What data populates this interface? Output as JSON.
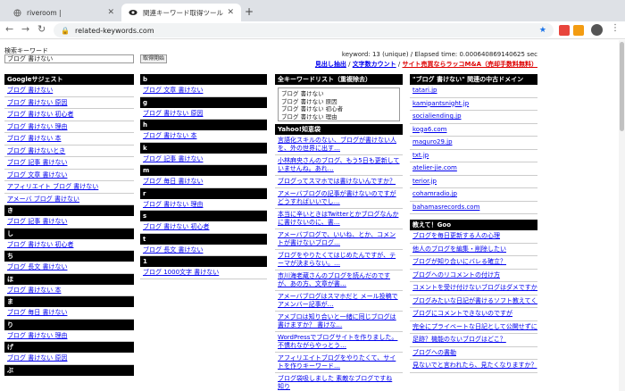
{
  "browser": {
    "tabs": [
      {
        "title": "riveroom |",
        "active": false
      },
      {
        "title": "関連キーワード取得ツール（仮名",
        "active": true
      }
    ],
    "url": "related-keywords.com"
  },
  "search": {
    "label": "検索キーワード",
    "value": "ブログ 書けない",
    "button": "取得開始"
  },
  "stats": "keyword: 13 (unique) / Elapsed time: 0.000640869140625 sec",
  "links": {
    "headings": "見出し抽出",
    "sep1": " / ",
    "count": "文字数カウント",
    "sep2": " / ",
    "sale": "サイト売買ならラッコM&A（売却手数料無料）"
  },
  "col1": [
    {
      "type": "hdr",
      "text": "Googleサジェスト"
    },
    {
      "type": "item",
      "text": "ブログ 書けない"
    },
    {
      "type": "item",
      "text": "ブログ 書けない 原因"
    },
    {
      "type": "item",
      "text": "ブログ 書けない 初心者"
    },
    {
      "type": "item",
      "text": "ブログ 書けない 理由"
    },
    {
      "type": "item",
      "text": "ブログ 書けない 本"
    },
    {
      "type": "item",
      "text": "ブログ 書けないとき"
    },
    {
      "type": "item",
      "text": "ブログ 記事 書けない"
    },
    {
      "type": "item",
      "text": "ブログ 文章 書けない"
    },
    {
      "type": "item",
      "text": "アフィリエイト ブログ 書けない"
    },
    {
      "type": "item",
      "text": "アメーバ ブログ 書けない"
    },
    {
      "type": "hdr",
      "text": "き"
    },
    {
      "type": "item",
      "text": "ブログ 記事 書けない"
    },
    {
      "type": "hdr",
      "text": "し"
    },
    {
      "type": "item",
      "text": "ブログ 書けない 初心者"
    },
    {
      "type": "hdr",
      "text": "ち"
    },
    {
      "type": "item",
      "text": "ブログ 長文 書けない"
    },
    {
      "type": "hdr",
      "text": "ほ"
    },
    {
      "type": "item",
      "text": "ブログ 書けない 本"
    },
    {
      "type": "hdr",
      "text": "ま"
    },
    {
      "type": "item",
      "text": "ブログ 毎日 書けない"
    },
    {
      "type": "hdr",
      "text": "り"
    },
    {
      "type": "item",
      "text": "ブログ 書けない 理由"
    },
    {
      "type": "hdr",
      "text": "げ"
    },
    {
      "type": "item",
      "text": "ブログ 書けない 原因"
    },
    {
      "type": "hdr",
      "text": "ぶ"
    }
  ],
  "col2": [
    {
      "type": "hdr",
      "text": "b"
    },
    {
      "type": "item",
      "text": "ブログ 文章 書けない"
    },
    {
      "type": "hdr",
      "text": "g"
    },
    {
      "type": "item",
      "text": "ブログ 書けない 原因"
    },
    {
      "type": "hdr",
      "text": "h"
    },
    {
      "type": "item",
      "text": "ブログ 書けない 本"
    },
    {
      "type": "hdr",
      "text": "k"
    },
    {
      "type": "item",
      "text": "ブログ 記事 書けない"
    },
    {
      "type": "hdr",
      "text": "m"
    },
    {
      "type": "item",
      "text": "ブログ 毎日 書けない"
    },
    {
      "type": "hdr",
      "text": "r"
    },
    {
      "type": "item",
      "text": "ブログ 書けない 理由"
    },
    {
      "type": "hdr",
      "text": "s"
    },
    {
      "type": "item",
      "text": "ブログ 書けない 初心者"
    },
    {
      "type": "hdr",
      "text": "t"
    },
    {
      "type": "item",
      "text": "ブログ 長文 書けない"
    },
    {
      "type": "hdr",
      "text": "1"
    },
    {
      "type": "item",
      "text": "ブログ 1000文字 書けない"
    }
  ],
  "col3": {
    "header": "全キーワードリスト（重複除去）",
    "textarea_lines": [
      "ブログ 書けない",
      "ブログ 書けない 原因",
      "ブログ 書けない 初心者",
      "ブログ 書けない 理由"
    ],
    "yahoo_header": "Yahoo!知恵袋",
    "yahoo_items": [
      "言語化スキルのない、ブログが書けない人を、外の世界に出す…",
      "小林麻央さんのブログ、もう5日も更新していませんね。あれ…",
      "ブログってスマホでは書けないんですか？",
      "アメーバブログの記事が書けないのですがどうすればいいでし…",
      "本当に辛いときはTwitterとかブログなんかに書けないのに、書…",
      "アメーバブログで、いいね、とか、コメントが書けないブログ…",
      "ブログをやりたくてはじめたんですが、テーマが決まらない。…",
      "市川海老蔵さんのブログを読んだのですが、あの方、文章が書…",
      "アメーバブログはスマホだと メール投稿でアメンバー記事が…",
      "アメブロは知り合いと一緒に同じブログは書けますか？ 書けな…",
      "WordPressでブログサイトを作りました。不慣れながらやっとう…",
      "アフィリエイトブログをやりたくて、サイトを作りキーワード…",
      "ブログ袋吸しました 素敵なブログですね 知り"
    ]
  },
  "col4": {
    "domain_header": "\"ブログ 書けない\" 関連の中古ドメイン",
    "domains": [
      "tatari.jp",
      "kamipantsnight.jp",
      "socialiending.jp",
      "koga6.com",
      "maguro29.jp",
      "txt.jp",
      "atelier-jie.com",
      "terior.jp",
      "cohamradio.jp",
      "bahamasrecords.com"
    ],
    "goo_header": "教えて！Goo",
    "goo_items": [
      "ブログを毎日更新する人の心理",
      "他人のブログを編集・削除したい",
      "ブログが知り合いにバレる確立？",
      "ブログへのリコメントの付け方",
      "コメントを受け付けないブログはダメですか？",
      "ブログみたいな日記が書けるソフト教えてください",
      "ブログにコメントできないのですが",
      "完全にプライベートな日記として公開せずに使えるブログ",
      "足跡？機能のないブログはどこ？",
      "ブログへの書勒",
      "見ないでと言われたら、見たくなりますか？"
    ]
  },
  "colors": {
    "header_bg": "#000000",
    "link": "#0000ee",
    "red_link": "#dd0000"
  }
}
